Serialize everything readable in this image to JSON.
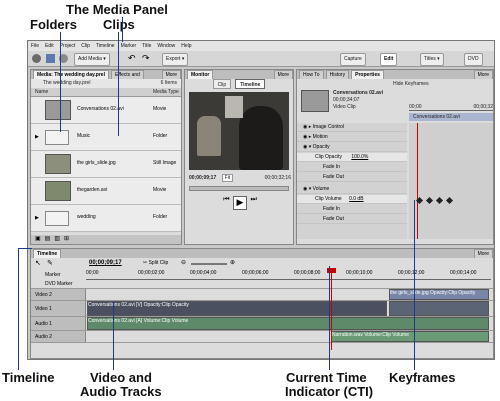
{
  "callouts": {
    "media_panel": "The Media Panel",
    "folders": "Folders",
    "clips": "Clips",
    "timeline": "Timeline",
    "video_audio_1": "Video and",
    "video_audio_2": "Audio Tracks",
    "cti_1": "Current Time",
    "cti_2": "Indicator (CTI)",
    "keyframes": "Keyframes"
  },
  "menu": [
    "File",
    "Edit",
    "Project",
    "Clip",
    "Timeline",
    "Marker",
    "Title",
    "Window",
    "Help"
  ],
  "toolbar": {
    "add_media": "Add Media",
    "export": "Export",
    "capture": "Capture",
    "edit": "Edit",
    "titles": "Titles",
    "dvd": "DVD"
  },
  "media_panel": {
    "tabs": [
      "Media: The wedding day.prel",
      "Effects and"
    ],
    "more": "More",
    "project_name": "The wedding day.prel",
    "item_count": "6 Items",
    "col_name": "Name",
    "col_type": "Media Type",
    "items": [
      {
        "name": "Conversations 02.avi",
        "type": "Movie",
        "kind": "clip"
      },
      {
        "name": "Music",
        "type": "Folder",
        "kind": "folder"
      },
      {
        "name": "the girls_slide.jpg",
        "type": "Still Image",
        "kind": "clip"
      },
      {
        "name": "thegarden.avi",
        "type": "Movie",
        "kind": "clip"
      },
      {
        "name": "wedding",
        "type": "Folder",
        "kind": "folder"
      }
    ]
  },
  "monitor": {
    "tab": "Monitor",
    "more": "More",
    "clip_tab": "Clip",
    "timeline_tab": "Timeline",
    "timecode": "00;00;09;17",
    "fit": "Fit",
    "duration": "00;00;32;16"
  },
  "properties": {
    "tabs": [
      "How To",
      "History",
      "Properties"
    ],
    "more": "More",
    "hide_keyframes": "Hide Keyframes",
    "clip_name": "Conversations 02.avi",
    "clip_duration": "00;00;34;07",
    "clip_kind": "Video Clip",
    "ruler_start": "00;00",
    "ruler_end": "00;00;32",
    "bar_clip": "Conversations 02.avi",
    "effects": [
      "Image Control",
      "Motion",
      "Opacity"
    ],
    "clip_opacity_label": "Clip Opacity",
    "clip_opacity_value": "100.0%",
    "fade_in": "Fade In",
    "fade_out": "Fade Out",
    "volume": "Volume",
    "clip_volume_label": "Clip Volume",
    "clip_volume_value": "0.0 dB"
  },
  "timeline": {
    "title": "Timeline",
    "more": "More",
    "timecode": "00;00;09;17",
    "split_clip": "Split Clip",
    "marker": "Marker",
    "dvd_marker": "DVD Marker",
    "ruler": [
      "00;00",
      "00;00;02;00",
      "00;00;04;00",
      "00;00;06;00",
      "00;00;08;00",
      "00;00;10;00",
      "00;00;12;00",
      "00;00;14;00"
    ],
    "tracks": [
      "Video 2",
      "Video 1",
      "Audio 1",
      "Audio 2"
    ],
    "clip_v1": "Conversations 02.avi [V] Opacity:Clip Opacity",
    "clip_v2": "the girls_slide.jpg Opacity:Clip Opacity",
    "clip_a1": "Conversations 02.avi [A] Volume:Clip Volume",
    "clip_a2": "Narration.wav Volume:Clip Volume",
    "zoom": "Narration"
  }
}
